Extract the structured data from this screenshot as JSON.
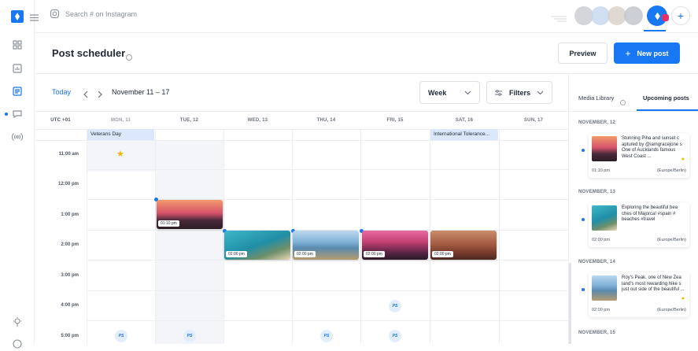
{
  "search": {
    "placeholder": "Search # on Instagram"
  },
  "page": {
    "title": "Post scheduler"
  },
  "actions": {
    "preview": "Preview",
    "new_post": "New post"
  },
  "nav": {
    "today": "Today",
    "range": "November 11 – 17",
    "view": "Week",
    "filters": "Filters"
  },
  "calendar": {
    "timezone": "UTC +01",
    "days": [
      "MON, 11",
      "TUE, 12",
      "WED, 13",
      "THU, 14",
      "FRI, 15",
      "SAT, 16",
      "SUN, 17"
    ],
    "times": [
      "11:00 am",
      "12:00 pm",
      "1:00 pm",
      "2:00 pm",
      "3:00 pm",
      "4:00 pm",
      "5:00 pm"
    ],
    "holidays": [
      "Veterans Day",
      "International Tolerance..."
    ],
    "posts": [
      {
        "day": "TUE, 12",
        "time": "01:10 pm"
      },
      {
        "day": "WED, 13",
        "time": "02:00 pm"
      },
      {
        "day": "THU, 14",
        "time": "02:00 pm"
      },
      {
        "day": "FRI, 15",
        "time": "02:00 pm"
      },
      {
        "day": "SAT, 16",
        "time": "02:00 pm"
      }
    ],
    "suggest_label": "PS"
  },
  "panel": {
    "tabs": [
      "Media Library",
      "Upcoming posts"
    ],
    "groups": [
      {
        "day": "NOVEMBER, 12",
        "text": "Stunning Piha and sunset c aptured by @iamgracejone s One of Aucklands famous West Coast ...",
        "time": "01:10 pm",
        "zone": "(Europe/Berlin)"
      },
      {
        "day": "NOVEMBER, 13",
        "text": "Exploring the beautiful bea ches of Majorca! #spain # beaches #travel",
        "time": "02:00 pm",
        "zone": "(Europe/Berlin)"
      },
      {
        "day": "NOVEMBER, 14",
        "text": "Roy's Peak, one of New Zea land's most rewarding hike s just out side of the beautiful ...",
        "time": "02:00 pm",
        "zone": "(Europe/Berlin)"
      },
      {
        "day": "NOVEMBER, 15",
        "text": "",
        "time": "",
        "zone": ""
      }
    ]
  },
  "colors": {
    "accent": "#1877f2",
    "today_bg": "#f3f5f8",
    "holiday_bg": "#dbe8fb"
  }
}
